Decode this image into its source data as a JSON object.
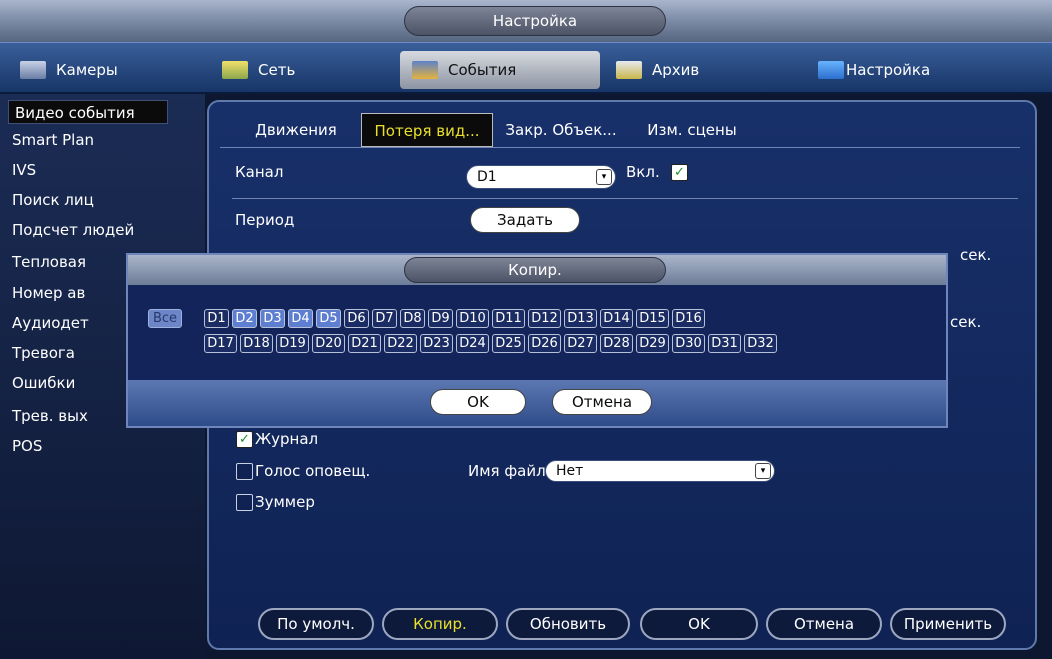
{
  "window": {
    "title": "Настройка"
  },
  "top_tabs": [
    {
      "label": "Камеры",
      "icon": "camera-icon"
    },
    {
      "label": "Сеть",
      "icon": "network-icon"
    },
    {
      "label": "События",
      "icon": "events-icon",
      "active": true
    },
    {
      "label": "Архив",
      "icon": "archive-icon"
    },
    {
      "label": "Настройка",
      "icon": "settings-icon"
    }
  ],
  "left_menu": [
    "Видео события",
    "Smart Plan",
    "IVS",
    "Поиск лиц",
    "Подсчет людей",
    "Тепловая",
    "Номер ав",
    "Аудиодет",
    "Тревога",
    "Ошибки",
    "Трев. вых",
    "POS"
  ],
  "sub_tabs": [
    "Движения",
    "Потеря вид...",
    "Закр. Объек...",
    "Изм. сцены"
  ],
  "form": {
    "channel_label": "Канал",
    "channel_value": "D1",
    "enable_label": "Вкл.",
    "period_label": "Период",
    "period_button": "Задать",
    "sec_label_1": "сек.",
    "sec_label_2": "сек.",
    "log_label": "Журнал",
    "voice_label": "Голос оповещ.",
    "file_name_label": "Имя файла",
    "file_name_value": "Нет",
    "buzzer_label": "Зуммер"
  },
  "modal": {
    "title": "Копир.",
    "all_label": "Все",
    "channels_row1": [
      "D1",
      "D2",
      "D3",
      "D4",
      "D5",
      "D6",
      "D7",
      "D8",
      "D9",
      "D10",
      "D11",
      "D12",
      "D13",
      "D14",
      "D15",
      "D16"
    ],
    "channels_row2": [
      "D17",
      "D18",
      "D19",
      "D20",
      "D21",
      "D22",
      "D23",
      "D24",
      "D25",
      "D26",
      "D27",
      "D28",
      "D29",
      "D30",
      "D31",
      "D32"
    ],
    "selected": [
      "D2",
      "D3",
      "D4",
      "D5"
    ],
    "ok_label": "OK",
    "cancel_label": "Отмена"
  },
  "bottom_buttons": {
    "default": "По умолч.",
    "copy": "Копир.",
    "refresh": "Обновить",
    "ok": "OK",
    "cancel": "Отмена",
    "apply": "Применить"
  },
  "colors": {
    "accent_yellow": "#e8e02c",
    "panel_blue": "#13245a",
    "selected_chip": "#5e7fd1"
  }
}
